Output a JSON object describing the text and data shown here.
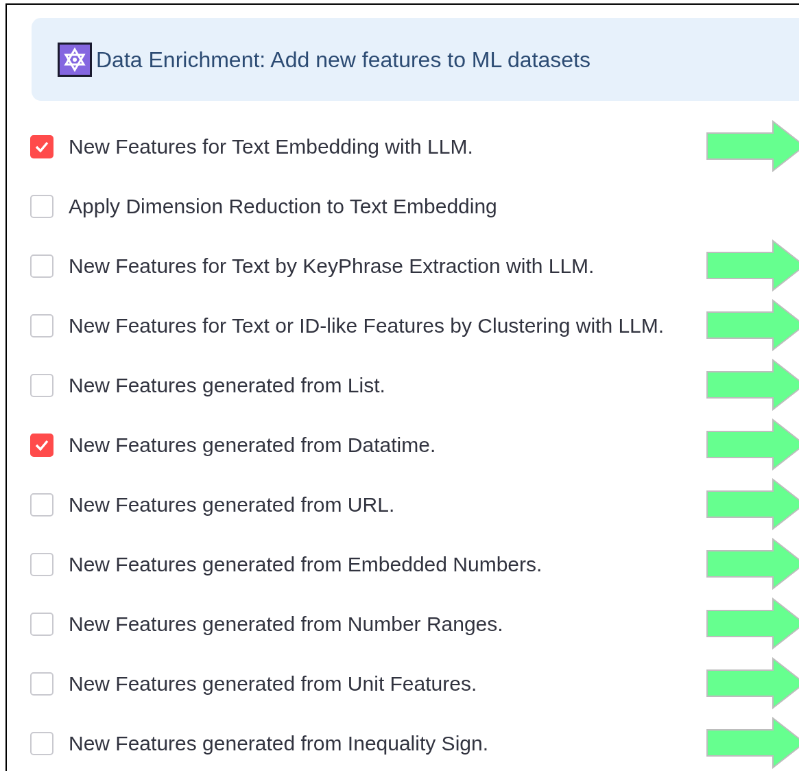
{
  "header": {
    "title": "Data Enrichment: Add new features to ML datasets"
  },
  "options": [
    {
      "label": "New Features for Text Embedding with LLM.",
      "checked": true,
      "arrow": true
    },
    {
      "label": "Apply Dimension Reduction to Text Embedding",
      "checked": false,
      "arrow": false
    },
    {
      "label": "New Features for Text by KeyPhrase Extraction with LLM.",
      "checked": false,
      "arrow": true
    },
    {
      "label": "New Features for Text or ID-like Features by Clustering with LLM.",
      "checked": false,
      "arrow": true
    },
    {
      "label": "New Features generated from List.",
      "checked": false,
      "arrow": true
    },
    {
      "label": "New Features generated from Datatime.",
      "checked": true,
      "arrow": true
    },
    {
      "label": "New Features generated from URL.",
      "checked": false,
      "arrow": true
    },
    {
      "label": "New Features generated from Embedded Numbers.",
      "checked": false,
      "arrow": true
    },
    {
      "label": "New Features generated from Number Ranges.",
      "checked": false,
      "arrow": true
    },
    {
      "label": "New Features generated from Unit Features.",
      "checked": false,
      "arrow": true
    },
    {
      "label": "New Features generated from Inequality Sign.",
      "checked": false,
      "arrow": true
    }
  ]
}
